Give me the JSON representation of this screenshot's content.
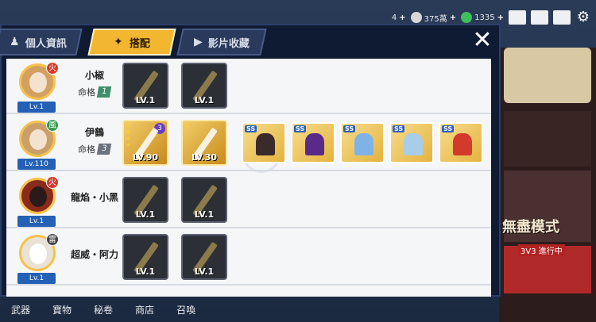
{
  "tabs": [
    {
      "label": "個人資訊",
      "icon": "character-icon",
      "active": false
    },
    {
      "label": "搭配",
      "icon": "shuriken-icon",
      "active": true
    },
    {
      "label": "影片收藏",
      "icon": "play-icon",
      "active": false
    }
  ],
  "topbar": {
    "res1": "4",
    "res2": "375萬",
    "res3": "1335"
  },
  "characters": [
    {
      "name": "小椒",
      "level": "Lv.1",
      "fate_label": "命格",
      "fate": "1",
      "element_color": "#d23b2b",
      "weapons": [
        {
          "level": "LV.1",
          "gold": false
        },
        {
          "level": "LV.1",
          "gold": false
        }
      ]
    },
    {
      "name": "伊鶴",
      "level": "Lv.110",
      "fate_label": "命格",
      "fate": "3",
      "element_color": "#2f9a4c",
      "weapons": [
        {
          "level": "LV.90",
          "gold": true,
          "rank": "3"
        },
        {
          "level": "LV.30",
          "gold": true
        }
      ],
      "accessories": [
        {
          "tag": "SS",
          "color": "#3a2a2a"
        },
        {
          "tag": "SS",
          "color": "#5a2a8a"
        },
        {
          "tag": "SS",
          "color": "#7fb3e6"
        },
        {
          "tag": "SS",
          "color": "#7fb3e6"
        },
        {
          "tag": "SS",
          "color": "#d23b2b"
        }
      ]
    },
    {
      "name": "龍焰・小黑",
      "level": "Lv.1",
      "element_color": "#d23b2b",
      "weapons": [
        {
          "level": "LV.1",
          "gold": false
        },
        {
          "level": "LV.1",
          "gold": false
        }
      ]
    },
    {
      "name": "超威・阿力",
      "level": "Lv.1",
      "element_color": "#444444",
      "weapons": [
        {
          "level": "LV.1",
          "gold": false
        },
        {
          "level": "LV.1",
          "gold": false
        }
      ]
    }
  ],
  "bottom_nav": [
    "武器",
    "寶物",
    "秘卷",
    "商店",
    "召喚"
  ],
  "mode": {
    "label": "無盡模式",
    "sub": "3V3 進行中"
  }
}
